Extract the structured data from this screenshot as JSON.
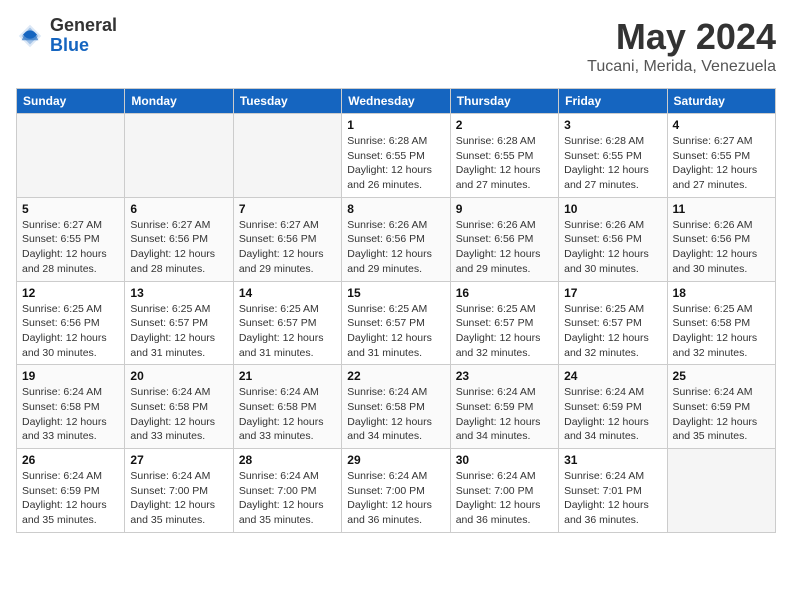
{
  "header": {
    "logo_general": "General",
    "logo_blue": "Blue",
    "month_title": "May 2024",
    "location": "Tucani, Merida, Venezuela"
  },
  "weekdays": [
    "Sunday",
    "Monday",
    "Tuesday",
    "Wednesday",
    "Thursday",
    "Friday",
    "Saturday"
  ],
  "weeks": [
    [
      {
        "day": "",
        "info": ""
      },
      {
        "day": "",
        "info": ""
      },
      {
        "day": "",
        "info": ""
      },
      {
        "day": "1",
        "info": "Sunrise: 6:28 AM\nSunset: 6:55 PM\nDaylight: 12 hours\nand 26 minutes."
      },
      {
        "day": "2",
        "info": "Sunrise: 6:28 AM\nSunset: 6:55 PM\nDaylight: 12 hours\nand 27 minutes."
      },
      {
        "day": "3",
        "info": "Sunrise: 6:28 AM\nSunset: 6:55 PM\nDaylight: 12 hours\nand 27 minutes."
      },
      {
        "day": "4",
        "info": "Sunrise: 6:27 AM\nSunset: 6:55 PM\nDaylight: 12 hours\nand 27 minutes."
      }
    ],
    [
      {
        "day": "5",
        "info": "Sunrise: 6:27 AM\nSunset: 6:55 PM\nDaylight: 12 hours\nand 28 minutes."
      },
      {
        "day": "6",
        "info": "Sunrise: 6:27 AM\nSunset: 6:56 PM\nDaylight: 12 hours\nand 28 minutes."
      },
      {
        "day": "7",
        "info": "Sunrise: 6:27 AM\nSunset: 6:56 PM\nDaylight: 12 hours\nand 29 minutes."
      },
      {
        "day": "8",
        "info": "Sunrise: 6:26 AM\nSunset: 6:56 PM\nDaylight: 12 hours\nand 29 minutes."
      },
      {
        "day": "9",
        "info": "Sunrise: 6:26 AM\nSunset: 6:56 PM\nDaylight: 12 hours\nand 29 minutes."
      },
      {
        "day": "10",
        "info": "Sunrise: 6:26 AM\nSunset: 6:56 PM\nDaylight: 12 hours\nand 30 minutes."
      },
      {
        "day": "11",
        "info": "Sunrise: 6:26 AM\nSunset: 6:56 PM\nDaylight: 12 hours\nand 30 minutes."
      }
    ],
    [
      {
        "day": "12",
        "info": "Sunrise: 6:25 AM\nSunset: 6:56 PM\nDaylight: 12 hours\nand 30 minutes."
      },
      {
        "day": "13",
        "info": "Sunrise: 6:25 AM\nSunset: 6:57 PM\nDaylight: 12 hours\nand 31 minutes."
      },
      {
        "day": "14",
        "info": "Sunrise: 6:25 AM\nSunset: 6:57 PM\nDaylight: 12 hours\nand 31 minutes."
      },
      {
        "day": "15",
        "info": "Sunrise: 6:25 AM\nSunset: 6:57 PM\nDaylight: 12 hours\nand 31 minutes."
      },
      {
        "day": "16",
        "info": "Sunrise: 6:25 AM\nSunset: 6:57 PM\nDaylight: 12 hours\nand 32 minutes."
      },
      {
        "day": "17",
        "info": "Sunrise: 6:25 AM\nSunset: 6:57 PM\nDaylight: 12 hours\nand 32 minutes."
      },
      {
        "day": "18",
        "info": "Sunrise: 6:25 AM\nSunset: 6:58 PM\nDaylight: 12 hours\nand 32 minutes."
      }
    ],
    [
      {
        "day": "19",
        "info": "Sunrise: 6:24 AM\nSunset: 6:58 PM\nDaylight: 12 hours\nand 33 minutes."
      },
      {
        "day": "20",
        "info": "Sunrise: 6:24 AM\nSunset: 6:58 PM\nDaylight: 12 hours\nand 33 minutes."
      },
      {
        "day": "21",
        "info": "Sunrise: 6:24 AM\nSunset: 6:58 PM\nDaylight: 12 hours\nand 33 minutes."
      },
      {
        "day": "22",
        "info": "Sunrise: 6:24 AM\nSunset: 6:58 PM\nDaylight: 12 hours\nand 34 minutes."
      },
      {
        "day": "23",
        "info": "Sunrise: 6:24 AM\nSunset: 6:59 PM\nDaylight: 12 hours\nand 34 minutes."
      },
      {
        "day": "24",
        "info": "Sunrise: 6:24 AM\nSunset: 6:59 PM\nDaylight: 12 hours\nand 34 minutes."
      },
      {
        "day": "25",
        "info": "Sunrise: 6:24 AM\nSunset: 6:59 PM\nDaylight: 12 hours\nand 35 minutes."
      }
    ],
    [
      {
        "day": "26",
        "info": "Sunrise: 6:24 AM\nSunset: 6:59 PM\nDaylight: 12 hours\nand 35 minutes."
      },
      {
        "day": "27",
        "info": "Sunrise: 6:24 AM\nSunset: 7:00 PM\nDaylight: 12 hours\nand 35 minutes."
      },
      {
        "day": "28",
        "info": "Sunrise: 6:24 AM\nSunset: 7:00 PM\nDaylight: 12 hours\nand 35 minutes."
      },
      {
        "day": "29",
        "info": "Sunrise: 6:24 AM\nSunset: 7:00 PM\nDaylight: 12 hours\nand 36 minutes."
      },
      {
        "day": "30",
        "info": "Sunrise: 6:24 AM\nSunset: 7:00 PM\nDaylight: 12 hours\nand 36 minutes."
      },
      {
        "day": "31",
        "info": "Sunrise: 6:24 AM\nSunset: 7:01 PM\nDaylight: 12 hours\nand 36 minutes."
      },
      {
        "day": "",
        "info": ""
      }
    ]
  ]
}
